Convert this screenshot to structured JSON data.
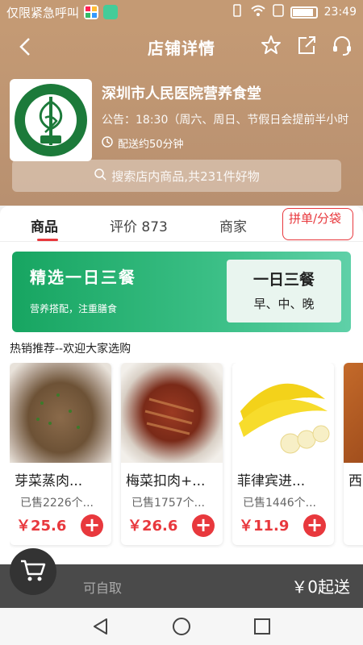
{
  "status": {
    "carrier": "仅限紧急呼叫",
    "time": "23:49",
    "battery_level": 0.85
  },
  "nav": {
    "title": "店铺详情",
    "icons": [
      "back-arrow-icon",
      "star-icon",
      "share-icon",
      "headset-icon"
    ]
  },
  "store": {
    "name": "深圳市人民医院营养食堂",
    "notice": "公告：18:30（周六、周日、节假日会提前半小时",
    "delivery_time": "配送约50分钟"
  },
  "search": {
    "placeholder": "搜索店内商品,共231件好物"
  },
  "tabs": {
    "goods": "商品",
    "reviews": "评价 873",
    "merchant": "商家",
    "group": "拼单/分袋"
  },
  "banner": {
    "title": "精选一日三餐",
    "subtitle": "营养搭配，注重膳食",
    "big": "一日三餐",
    "small": "早、中、晚"
  },
  "section_title": "热销推荐--欢迎大家选购",
  "products": [
    {
      "name": "芽菜蒸肉...",
      "sold": "已售2226个...",
      "price": "￥25.6"
    },
    {
      "name": "梅菜扣肉+...",
      "sold": "已售1757个...",
      "price": "￥26.6"
    },
    {
      "name": "菲律宾进...",
      "sold": "已售1446个...",
      "price": "￥11.9"
    },
    {
      "name": "西",
      "sold": "",
      "price": ""
    }
  ],
  "cart": {
    "self_pickup": "可自取",
    "min_delivery": "￥0起送"
  },
  "colors": {
    "header": "#c49a74",
    "accent": "#e8383d",
    "banner": "#17a561",
    "cartbar": "#4a4a4a"
  }
}
